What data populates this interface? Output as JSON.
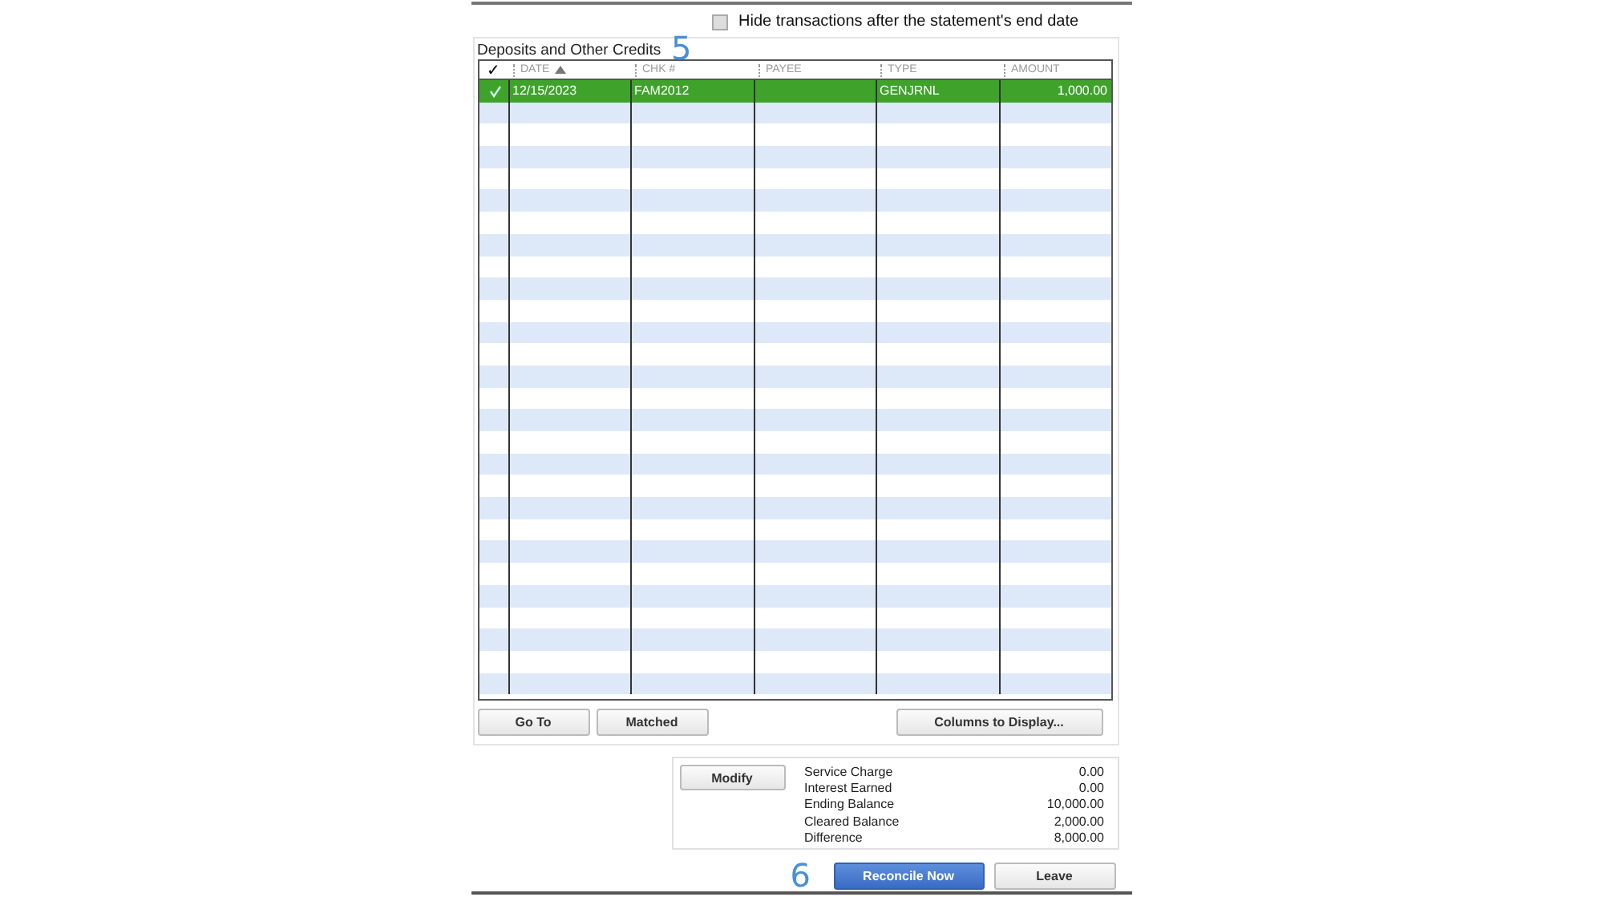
{
  "hide_option": {
    "label": "Hide transactions after the statement's end date",
    "checked": false
  },
  "section": {
    "title": "Deposits and Other Credits",
    "callout": "5"
  },
  "table": {
    "columns": [
      {
        "label": "✓",
        "kind": "check"
      },
      {
        "label": "DATE",
        "kind": "sorted"
      },
      {
        "label": "CHK #",
        "kind": "text"
      },
      {
        "label": "PAYEE",
        "kind": "text"
      },
      {
        "label": "TYPE",
        "kind": "text"
      },
      {
        "label": "AMOUNT",
        "kind": "text"
      }
    ],
    "rows": [
      {
        "checked": true,
        "selected": true,
        "cells": [
          "",
          "12/15/2023",
          "FAM2012",
          "",
          "GENJRNL",
          "1,000.00"
        ]
      }
    ]
  },
  "buttons": [
    {
      "label": "Go To"
    },
    {
      "label": "Matched"
    },
    {
      "label": "Columns to Display..."
    }
  ],
  "summary": {
    "button": "Modify",
    "items": [
      {
        "label": "Service Charge",
        "value": "0.00"
      },
      {
        "label": "Interest Earned",
        "value": "0.00"
      },
      {
        "label": "Ending Balance",
        "value": "10,000.00"
      },
      {
        "label": "Cleared Balance",
        "value": "2,000.00"
      },
      {
        "label": "Difference",
        "value": "8,000.00"
      }
    ]
  },
  "footer": {
    "callout": "6",
    "primary": "Reconcile Now",
    "secondary": "Leave"
  }
}
